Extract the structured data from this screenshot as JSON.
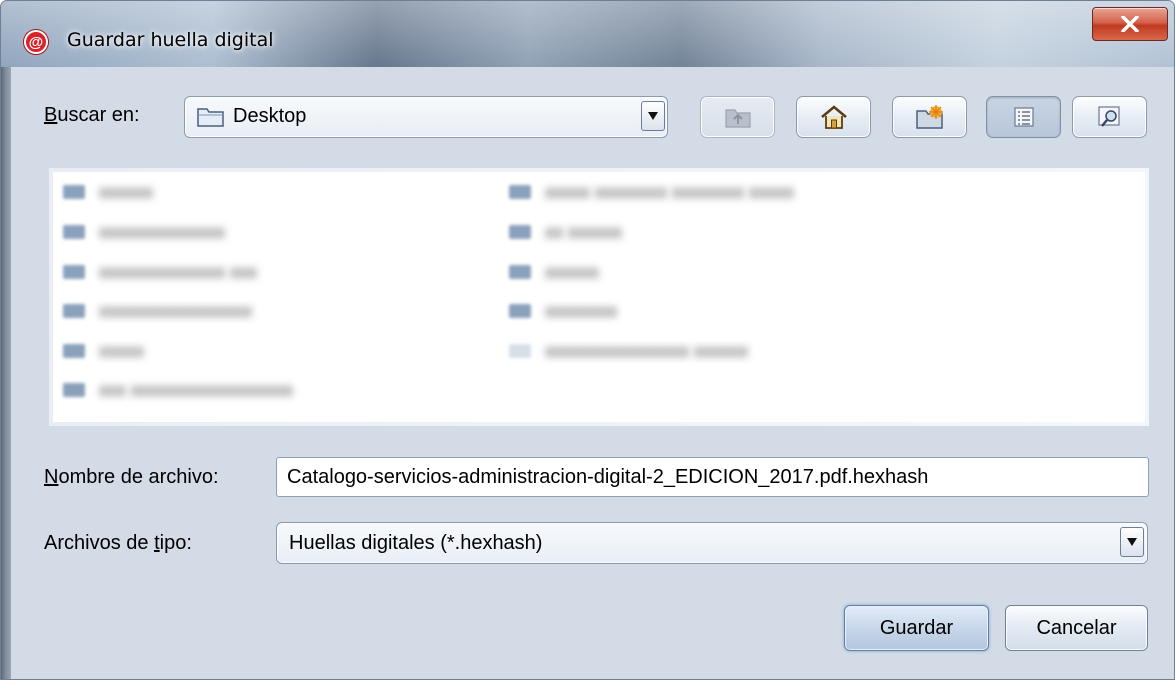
{
  "window": {
    "title": "Guardar huella digital"
  },
  "lookin": {
    "label_underline": "B",
    "label_rest": "uscar en:",
    "value": "Desktop"
  },
  "toolbar": {
    "up_icon": "up-folder-icon",
    "home_icon": "home-icon",
    "newfolder_icon": "new-folder-icon",
    "list_icon": "list-view-icon",
    "details_icon": "details-view-icon"
  },
  "files": {
    "note": "",
    "left_column": [
      "xxxxxx",
      "xxxxxxxxxxxxxx",
      "xxxxxxxxxxxxxx xxx",
      "xxxxxxxxxxxxxxxxx",
      "xxxxx",
      "xxx xxxxxxxxxxxxxxxxxx"
    ],
    "right_column": [
      "xxxxx xxxxxxxx xxxxxxxx xxxxx",
      "xx xxxxxx",
      "xxxxxx",
      "xxxxxxxx",
      "xxxxxxxxxxxxxxxx xxxxxx"
    ]
  },
  "filename": {
    "label_underline": "N",
    "label_rest": "ombre de archivo:",
    "value": "Catalogo-servicios-administracion-digital-2_EDICION_2017.pdf.hexhash"
  },
  "filetype": {
    "label_before": "Archivos de ",
    "label_underline": "t",
    "label_after": "ipo:",
    "value": "Huellas digitales (*.hexhash)"
  },
  "buttons": {
    "save": "Guardar",
    "cancel": "Cancelar"
  },
  "colors": {
    "accent": "#d8232a",
    "close": "#c1391f",
    "background": "#d7dee8"
  }
}
